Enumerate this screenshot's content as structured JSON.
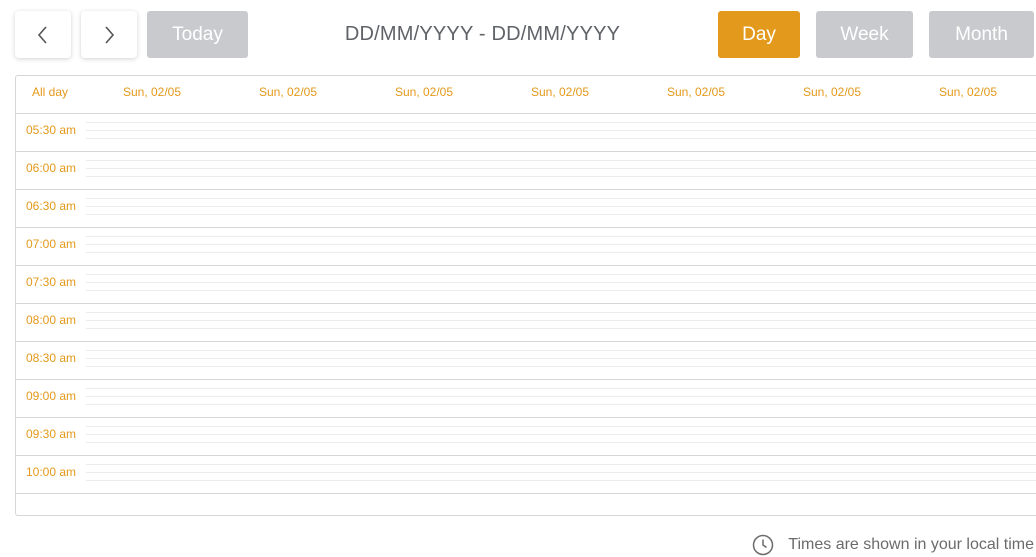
{
  "toolbar": {
    "prev_icon": "chevron-left-icon",
    "next_icon": "chevron-right-icon",
    "today_label": "Today",
    "date_range": "DD/MM/YYYY - DD/MM/YYYY",
    "views": [
      {
        "label": "Day",
        "active": true
      },
      {
        "label": "Week",
        "active": false
      },
      {
        "label": "Month",
        "active": false
      }
    ]
  },
  "calendar": {
    "all_day_label": "All day",
    "day_headers": [
      "Sun, 02/05",
      "Sun, 02/05",
      "Sun, 02/05",
      "Sun, 02/05",
      "Sun, 02/05",
      "Sun, 02/05",
      "Sun, 02/05"
    ],
    "time_slots": [
      "05:30 am",
      "06:00 am",
      "06:30 am",
      "07:00 am",
      "07:30 am",
      "08:00 am",
      "08:30 am",
      "09:00 am",
      "09:30 am",
      "10:00 am"
    ]
  },
  "footer": {
    "icon": "clock-icon",
    "note": "Times are shown in your local time"
  },
  "colors": {
    "accent": "#e3991b",
    "button_inactive": "#c8cacd",
    "border": "#d6d6d6"
  }
}
